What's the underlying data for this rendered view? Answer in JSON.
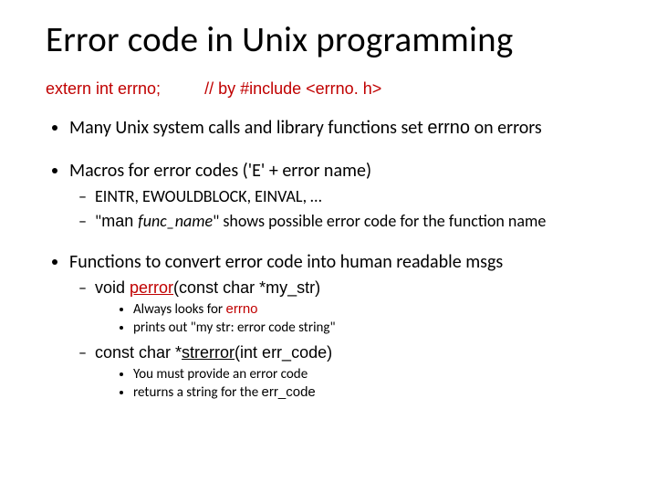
{
  "title": "Error code in Unix programming",
  "decl": {
    "left": "extern int  errno;",
    "right": "// by #include <errno. h>"
  },
  "b1": {
    "pre": "Many Unix system calls and library functions set ",
    "code": "errno",
    "post": " on errors"
  },
  "b2": {
    "text": "Macros for error codes ('E' + error name)",
    "s1": "EINTR, EWOULDBLOCK, EINVAL, …",
    "s2p1": "\"",
    "s2p2": "man ",
    "s2p3": "func_name",
    "s2p4": "\" shows possible error code for the function name"
  },
  "b3": {
    "text": "Functions to convert error code into human readable msgs",
    "s1p1": "void ",
    "s1p2": "perror",
    "s1p3": "(const char *my_str)",
    "s1a": "Always looks for ",
    "s1a2": "errno",
    "s1b": "prints out \"my str: error code string\"",
    "s2p1": "const char *",
    "s2p2": "strerror",
    "s2p3": "(int err_code)",
    "s2a": "You must provide an error code",
    "s2b1": "returns a string for the ",
    "s2b2": "err_code"
  }
}
